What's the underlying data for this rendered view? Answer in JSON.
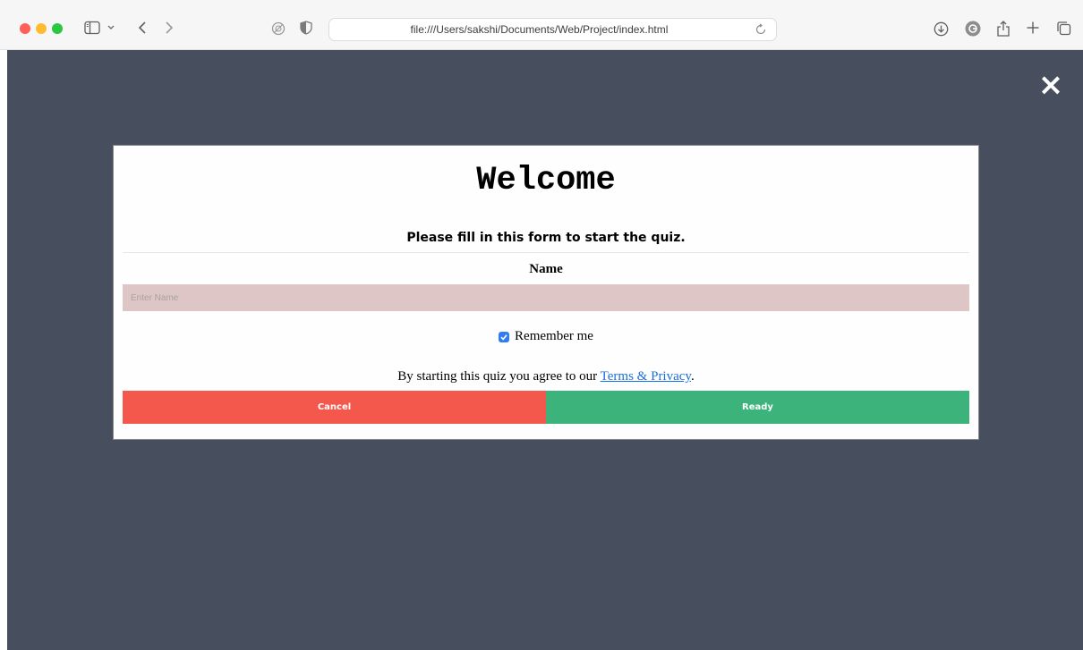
{
  "browser": {
    "url": "file:///Users/sakshi/Documents/Web/Project/index.html",
    "icons": {
      "sidebar": "sidebar-icon",
      "tab_overview_chevron": "chevron-down-icon",
      "back": "chevron-left-icon",
      "forward": "chevron-right-icon",
      "privacy_report": "privacy-report-icon",
      "shield": "shield-icon",
      "reload": "reload-icon",
      "downloads": "download-icon",
      "profile": "profile-icon",
      "share": "share-icon",
      "new_tab": "plus-icon",
      "tab_overview": "tab-overview-icon"
    }
  },
  "page": {
    "background_color": "#474e5d",
    "close_symbol": "×",
    "modal": {
      "title": "Welcome",
      "subtitle": "Please fill in this form to start the quiz.",
      "name_label": "Name",
      "name_input": {
        "value": "",
        "placeholder": "Enter Name"
      },
      "remember": {
        "checked": true,
        "label": "Remember me"
      },
      "terms": {
        "prefix": "By starting this quiz you agree to our ",
        "link_text": "Terms & Privacy",
        "suffix": "."
      },
      "buttons": {
        "cancel": "Cancel",
        "ready": "Ready"
      }
    }
  },
  "colors": {
    "cancel": "#f4584c",
    "ready": "#3cb37b",
    "input_bg": "#dec6c6",
    "link": "#1a6fdc",
    "checkbox": "#2f7cf6"
  }
}
